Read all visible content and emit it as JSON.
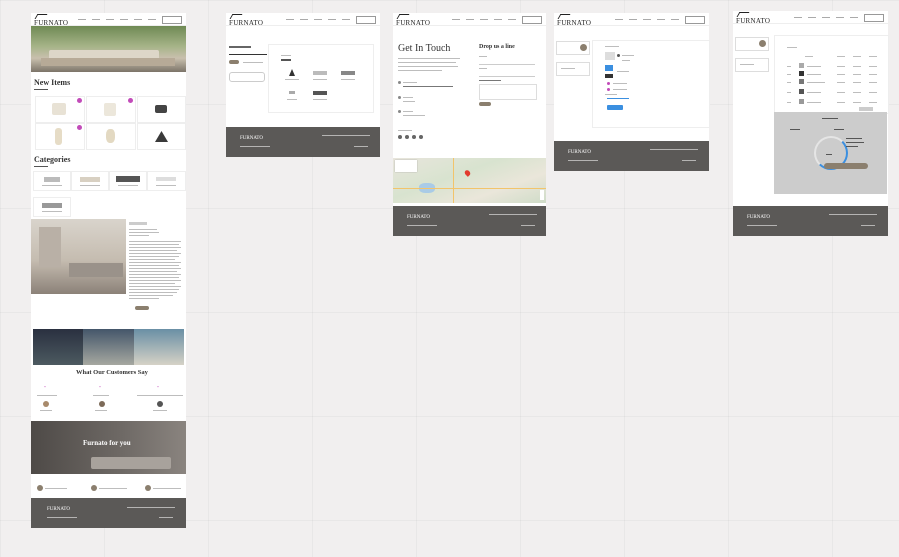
{
  "brand": {
    "logo_text": "FURNATO"
  },
  "home": {
    "new_items_title": "New Items",
    "categories_title": "Categories",
    "testimonials_title": "What Our Customers Say",
    "banner_text": "Furnato for you"
  },
  "contact": {
    "title": "Get In Touch",
    "form_title": "Drop us a line"
  },
  "colors": {
    "accent": "#8b7f6e",
    "footer": "#5b5957",
    "badge": "#c24bb9",
    "link_blue": "#3b8fe0"
  }
}
